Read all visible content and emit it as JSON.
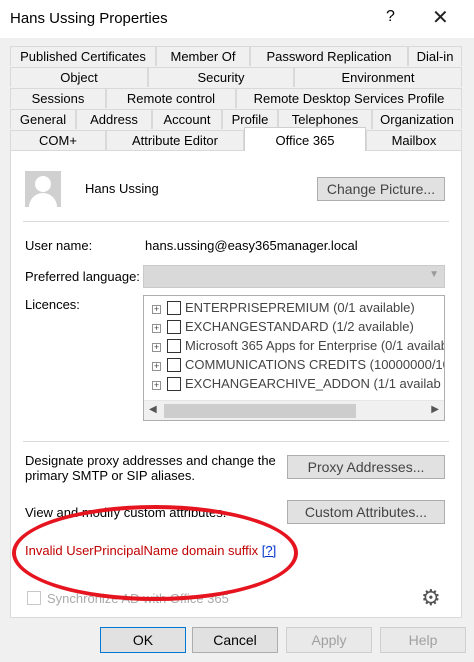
{
  "window": {
    "title": "Hans Ussing Properties",
    "help_glyph": "?",
    "close_glyph": "✕"
  },
  "tabs": {
    "row1": [
      "Published Certificates",
      "Member Of",
      "Password Replication",
      "Dial-in"
    ],
    "row2": [
      "Object",
      "Security",
      "Environment"
    ],
    "row3": [
      "Sessions",
      "Remote control",
      "Remote Desktop Services Profile"
    ],
    "row4": [
      "General",
      "Address",
      "Account",
      "Profile",
      "Telephones",
      "Organization"
    ],
    "row5": [
      "COM+",
      "Attribute Editor",
      "Office 365",
      "Mailbox"
    ],
    "active": "Office 365"
  },
  "user": {
    "display_name": "Hans Ussing",
    "change_picture_label": "Change Picture..."
  },
  "form": {
    "username_label": "User name:",
    "username_value": "hans.ussing@easy365manager.local",
    "language_label": "Preferred language:",
    "language_value": "",
    "licences_label": "Licences:"
  },
  "licences": [
    {
      "name": "ENTERPRISEPREMIUM (0/1 available)",
      "checked": false
    },
    {
      "name": "EXCHANGESTANDARD (1/2 available)",
      "checked": false
    },
    {
      "name": "Microsoft 365 Apps for Enterprise (0/1 availab",
      "checked": false
    },
    {
      "name": "COMMUNICATIONS CREDITS (10000000/10",
      "checked": false
    },
    {
      "name": "EXCHANGEARCHIVE_ADDON (1/1 availab",
      "checked": false
    }
  ],
  "proxy": {
    "description_line1": "Designate proxy addresses and change the",
    "description_line2": "primary SMTP or SIP aliases.",
    "button_label": "Proxy Addresses..."
  },
  "custom": {
    "description": "View and modify custom attributes.",
    "button_label": "Custom Attributes..."
  },
  "error": {
    "message": "Invalid UserPrincipalName domain suffix",
    "help_link": "[?]",
    "highlight_color": "#e5141e"
  },
  "sync": {
    "label": "Synchronize AD with Office 365",
    "checked": false
  },
  "footer": {
    "ok_label": "OK",
    "cancel_label": "Cancel",
    "apply_label": "Apply",
    "help_label": "Help"
  }
}
